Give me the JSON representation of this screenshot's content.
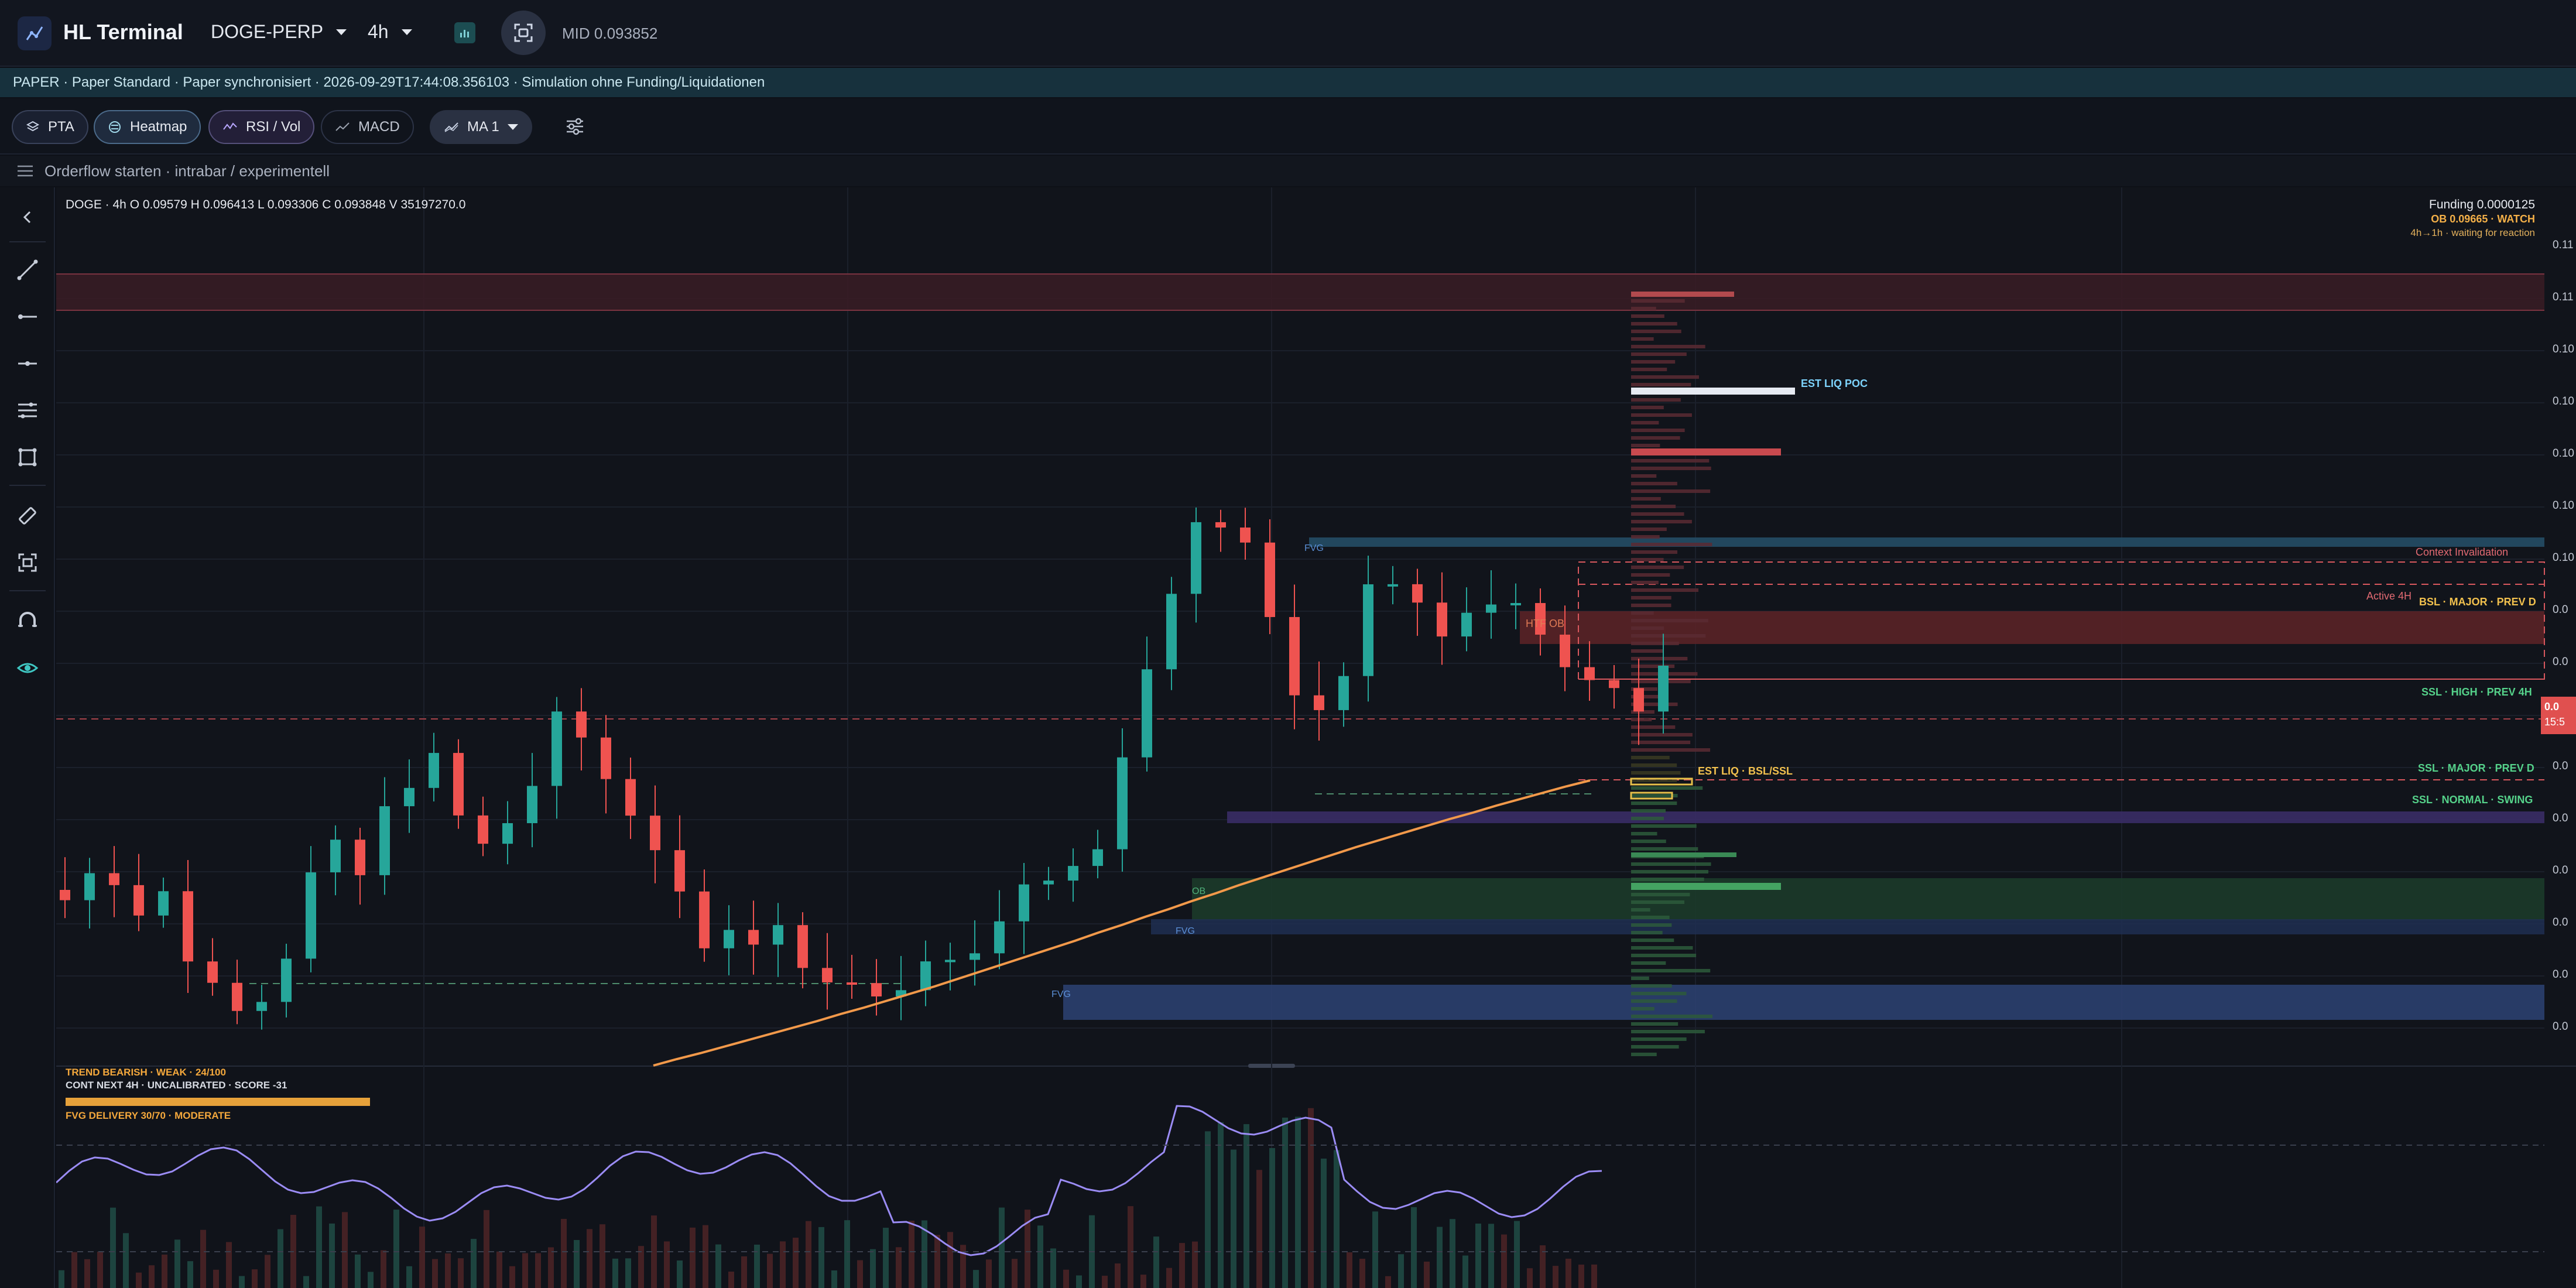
{
  "header": {
    "app_title": "HL Terminal",
    "symbol": "DOGE-PERP",
    "timeframe": "4h",
    "mid_label": "MID 0.093852"
  },
  "banner": {
    "text": "PAPER · Paper Standard · Paper synchronisiert · 2026-09-29T17:44:08.356103 · Simulation ohne Funding/Liquidationen"
  },
  "toolbar": {
    "pta_label": "PTA",
    "heatmap_label": "Heatmap",
    "rsi_label": "RSI / Vol",
    "macd_label": "MACD",
    "ma_label": "MA 1"
  },
  "orderflow": {
    "text": "Orderflow starten · intrabar / experimentell"
  },
  "chart": {
    "ohlc": "DOGE · 4h   O 0.09579   H 0.096413   L 0.093306   C 0.093848   V 35197270.0",
    "funding": "Funding 0.0000125",
    "ob_watch": "OB 0.09665 · WATCH",
    "wait_text": "4h→1h · waiting for reaction",
    "labels": {
      "est_liq_poc": "EST LIQ POC",
      "context_invalidation": "Context Invalidation",
      "active_4h": "Active 4H",
      "bsl_major": "BSL · MAJOR · PREV D",
      "htf_ob": "HTF OB",
      "ssl_high": "SSL · HIGH · PREV 4H",
      "est_liq_bsl": "EST LIQ · BSL/SSL",
      "ssl_major": "SSL · MAJOR · PREV D",
      "ssl_normal": "SSL · NORMAL · SWING",
      "fvg1": "FVG",
      "fvg2": "FVG",
      "fvg3": "FVG",
      "ob": "OB"
    },
    "price_axis": [
      "0.11",
      "0.11",
      "0.10",
      "0.10",
      "0.10",
      "0.10",
      "0.10",
      "0.0",
      "0.0",
      "0.0",
      "0.0",
      "0.0",
      "0.0",
      "0.0",
      "0.0",
      "0.0"
    ],
    "last_price_tag": "0.0",
    "countdown_tag": "15:5"
  },
  "indicators": {
    "trend": "TREND BEARISH · WEAK · 24/100",
    "cont": "CONT NEXT 4H · UNCALIBRATED · SCORE -31",
    "fvg_delivery": "FVG DELIVERY 30/70 · MODERATE"
  },
  "colors": {
    "bull": "#26a69a",
    "bear": "#ef5350",
    "accent": "#7dd3fc",
    "orange": "#f2994a"
  }
}
